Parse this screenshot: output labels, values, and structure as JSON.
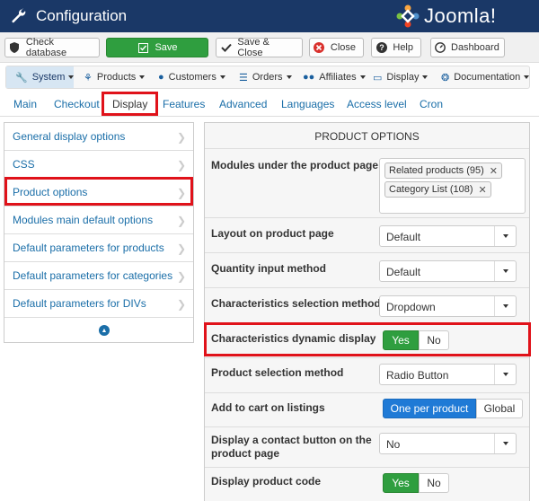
{
  "header": {
    "title": "Configuration",
    "brand": "Joomla!",
    "bg_color": "#1a3867"
  },
  "toolbar": {
    "check_database": "Check database",
    "save": "Save",
    "save_close": "Save & Close",
    "close": "Close",
    "help": "Help",
    "dashboard": "Dashboard"
  },
  "menu": {
    "system": "System",
    "products": "Products",
    "customers": "Customers",
    "orders": "Orders",
    "affiliates": "Affiliates",
    "display": "Display",
    "documentation": "Documentation"
  },
  "tabs": {
    "main": "Main",
    "checkout": "Checkout",
    "display": "Display",
    "features": "Features",
    "advanced": "Advanced",
    "languages": "Languages",
    "access_level": "Access level",
    "cron": "Cron"
  },
  "sidebar": {
    "items": [
      "General display options",
      "CSS",
      "Product options",
      "Modules main default options",
      "Default parameters for products",
      "Default parameters for categories",
      "Default parameters for DIVs"
    ]
  },
  "panel": {
    "title": "PRODUCT OPTIONS",
    "modules_label": "Modules under the product page",
    "modules_tags": [
      "Related products (95)",
      "Category List (108)"
    ],
    "layout_label": "Layout on product page",
    "layout_value": "Default",
    "quantity_label": "Quantity input method",
    "quantity_value": "Default",
    "characteristics_label": "Characteristics selection method",
    "characteristics_value": "Dropdown",
    "dynamic_label": "Characteristics dynamic display",
    "selection_label": "Product selection method",
    "selection_value": "Radio Button",
    "add_to_cart_label": "Add to cart on listings",
    "add_to_cart_on": "One per product",
    "add_to_cart_off": "Global",
    "contact_label_1": "Display a contact button on the",
    "contact_label_2": "product page",
    "contact_value": "No",
    "code_label": "Display product code",
    "yes": "Yes",
    "no": "No"
  }
}
